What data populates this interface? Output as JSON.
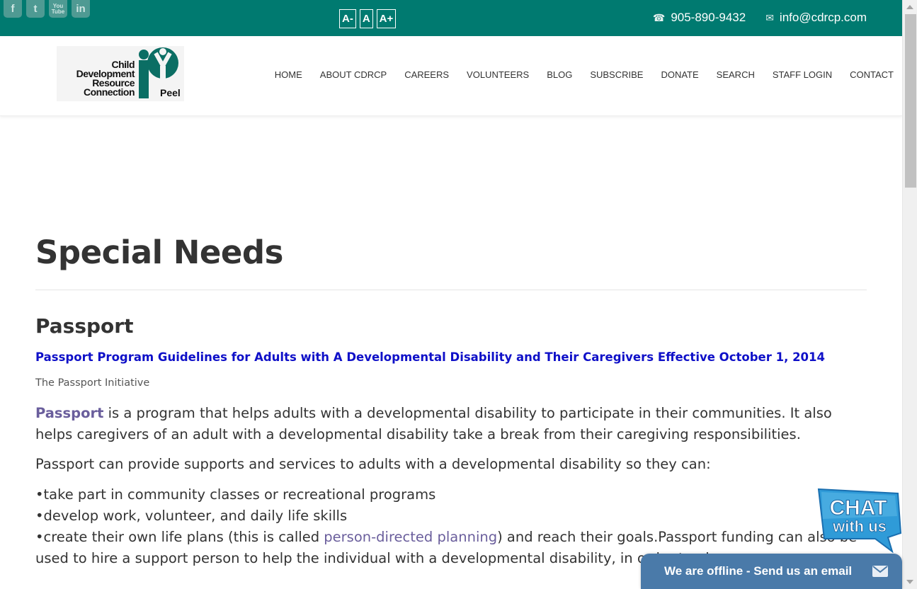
{
  "topbar": {
    "social": [
      {
        "icon": "facebook-icon",
        "glyph": "f"
      },
      {
        "icon": "twitter-icon",
        "glyph": "t"
      },
      {
        "icon": "youtube-icon",
        "glyph": "You Tube"
      },
      {
        "icon": "linkedin-icon",
        "glyph": "in"
      }
    ],
    "font_sizes": [
      "A-",
      "A",
      "A+"
    ],
    "phone": "905-890-9432",
    "email": "info@cdrcp.com",
    "color": "#007a70"
  },
  "logo": {
    "lines": [
      "Child",
      "Development",
      "Resource",
      "Connection"
    ],
    "peel": "Peel"
  },
  "nav": [
    "HOME",
    "ABOUT CDRCP",
    "CAREERS",
    "VOLUNTEERS",
    "BLOG",
    "SUBSCRIBE",
    "DONATE",
    "SEARCH",
    "STAFF LOGIN",
    "CONTACT"
  ],
  "page": {
    "title": "Special Needs",
    "section": "Passport",
    "guideline_link": "Passport Program Guidelines for Adults with A Developmental Disability and Their Caregivers Effective October 1, 2014",
    "initiative": "The Passport Initiative",
    "p1_link": "Passport",
    "p1_rest": " is a program that helps adults with a developmental disability to participate in their communities. It also helps caregivers of an adult with a developmental disability take a break from their caregiving responsibilities.",
    "p2": "Passport can provide supports and services to adults with a developmental disability so they can:",
    "bullet1": "•take part in community classes or recreational programs",
    "bullet2": "•develop work, volunteer, and daily life skills",
    "bullet3_pre": "•create their own life plans (this is called ",
    "bullet3_link": "person-directed planning",
    "bullet3_post": ") and reach their goals.Passport funding can also be used to hire a support person to help the individual with a developmental disability, in order to give"
  },
  "chat": {
    "badge_line1": "CHAT",
    "badge_line2": "with us",
    "bar_label": "We are offline - Send us an email"
  }
}
